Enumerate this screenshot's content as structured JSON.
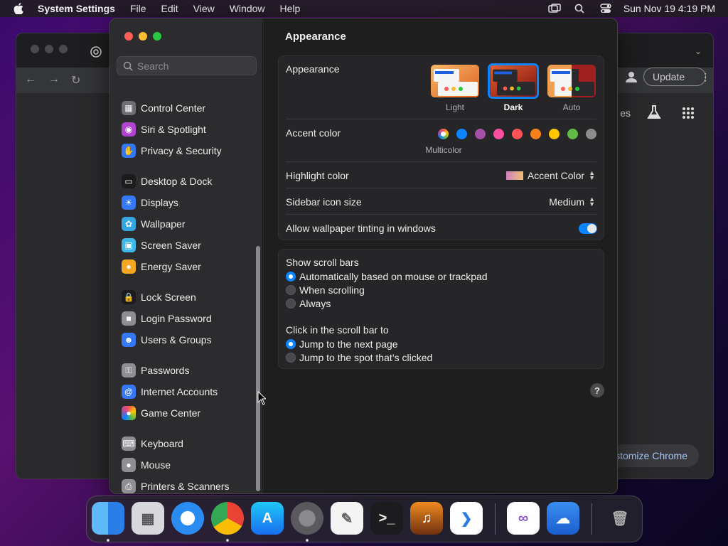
{
  "menubar": {
    "app_name": "System Settings",
    "menus": [
      "File",
      "Edit",
      "View",
      "Window",
      "Help"
    ],
    "clock": "Sun Nov 19  4:19 PM"
  },
  "chrome": {
    "update_label": "Update",
    "partial_link": "es",
    "customize_label": "ustomize Chrome"
  },
  "settings": {
    "search_placeholder": "Search",
    "sidebar_items": [
      {
        "label": "Control Center",
        "icon": "control-center-icon",
        "color": "#6e6e73"
      },
      {
        "label": "Siri & Spotlight",
        "icon": "siri-icon",
        "color": "#b044d0"
      },
      {
        "label": "Privacy & Security",
        "icon": "hand-icon",
        "color": "#3478f6"
      },
      {
        "label": "Desktop & Dock",
        "icon": "dock-icon",
        "color": "#1c1c1e"
      },
      {
        "label": "Displays",
        "icon": "sun-icon",
        "color": "#3478f6"
      },
      {
        "label": "Wallpaper",
        "icon": "flower-icon",
        "color": "#33a7e0"
      },
      {
        "label": "Screen Saver",
        "icon": "screensaver-icon",
        "color": "#3fb8e8"
      },
      {
        "label": "Energy Saver",
        "icon": "bulb-icon",
        "color": "#f5a623"
      },
      {
        "label": "Lock Screen",
        "icon": "lock-icon",
        "color": "#1c1c1e"
      },
      {
        "label": "Login Password",
        "icon": "padlock-icon",
        "color": "#8e8e93"
      },
      {
        "label": "Users & Groups",
        "icon": "users-icon",
        "color": "#3478f6"
      },
      {
        "label": "Passwords",
        "icon": "key-icon",
        "color": "#8e8e93"
      },
      {
        "label": "Internet Accounts",
        "icon": "at-icon",
        "color": "#3478f6"
      },
      {
        "label": "Game Center",
        "icon": "game-center-icon",
        "color": "#ffffff"
      },
      {
        "label": "Keyboard",
        "icon": "keyboard-icon",
        "color": "#8e8e93"
      },
      {
        "label": "Mouse",
        "icon": "mouse-icon",
        "color": "#8e8e93"
      },
      {
        "label": "Printers & Scanners",
        "icon": "printer-icon",
        "color": "#8e8e93"
      }
    ],
    "page_title": "Appearance",
    "appearance": {
      "label": "Appearance",
      "options": [
        "Light",
        "Dark",
        "Auto"
      ],
      "selected": "Dark"
    },
    "accent": {
      "label": "Accent color",
      "selected_name": "Multicolor",
      "colors": [
        "#ffffff",
        "#0a84ff",
        "#a550a7",
        "#f74f9e",
        "#ff5257",
        "#f7821b",
        "#ffc600",
        "#62ba46",
        "#8c8c8c"
      ]
    },
    "highlight": {
      "label": "Highlight color",
      "value": "Accent Color"
    },
    "sidebar_icon_size": {
      "label": "Sidebar icon size",
      "value": "Medium"
    },
    "tinting": {
      "label": "Allow wallpaper tinting in windows",
      "on": true
    },
    "scroll_bars": {
      "label": "Show scroll bars",
      "options": [
        "Automatically based on mouse or trackpad",
        "When scrolling",
        "Always"
      ],
      "selected": 0
    },
    "click_scroll": {
      "label": "Click in the scroll bar to",
      "options": [
        "Jump to the next page",
        "Jump to the spot that’s clicked"
      ],
      "selected": 0
    },
    "help": "?"
  },
  "dock": {
    "apps": [
      "finder-icon",
      "launchpad-icon",
      "safari-icon",
      "chrome-icon",
      "app-store-icon",
      "system-settings-icon",
      "textedit-icon",
      "terminal-icon",
      "garageband-icon",
      "vscode-icon",
      "visual-studio-icon",
      "weather-icon",
      "trash-icon"
    ]
  }
}
